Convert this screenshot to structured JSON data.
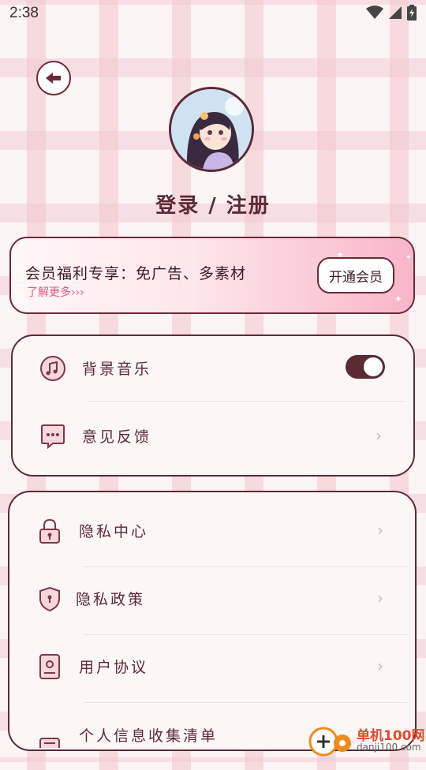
{
  "status_bar": {
    "time": "2:38",
    "icons": [
      "wifi-icon",
      "signal-icon",
      "battery-icon"
    ]
  },
  "header": {
    "login_label": "登录 / 注册"
  },
  "member": {
    "title": "会员福利专享：免广告、多素材",
    "more_label": "了解更多›››",
    "open_button": "开通会员"
  },
  "settings_group1": {
    "items": [
      {
        "label": "背景音乐",
        "icon": "music-note-icon",
        "toggle_on": true
      },
      {
        "label": "意见反馈",
        "icon": "chat-bubble-icon"
      }
    ]
  },
  "settings_group2": {
    "items": [
      {
        "label": "隐私中心",
        "icon": "lock-icon"
      },
      {
        "label": "隐私政策",
        "icon": "shield-icon"
      },
      {
        "label": "用户协议",
        "icon": "document-icon"
      },
      {
        "label": "个人信息收集清单",
        "icon": "list-icon"
      }
    ]
  },
  "watermark": {
    "title": "单机100网",
    "url": "danji100.com"
  },
  "colors": {
    "accent": "#5a2a35",
    "pink": "#f8b6c8",
    "link": "#e05a82"
  }
}
